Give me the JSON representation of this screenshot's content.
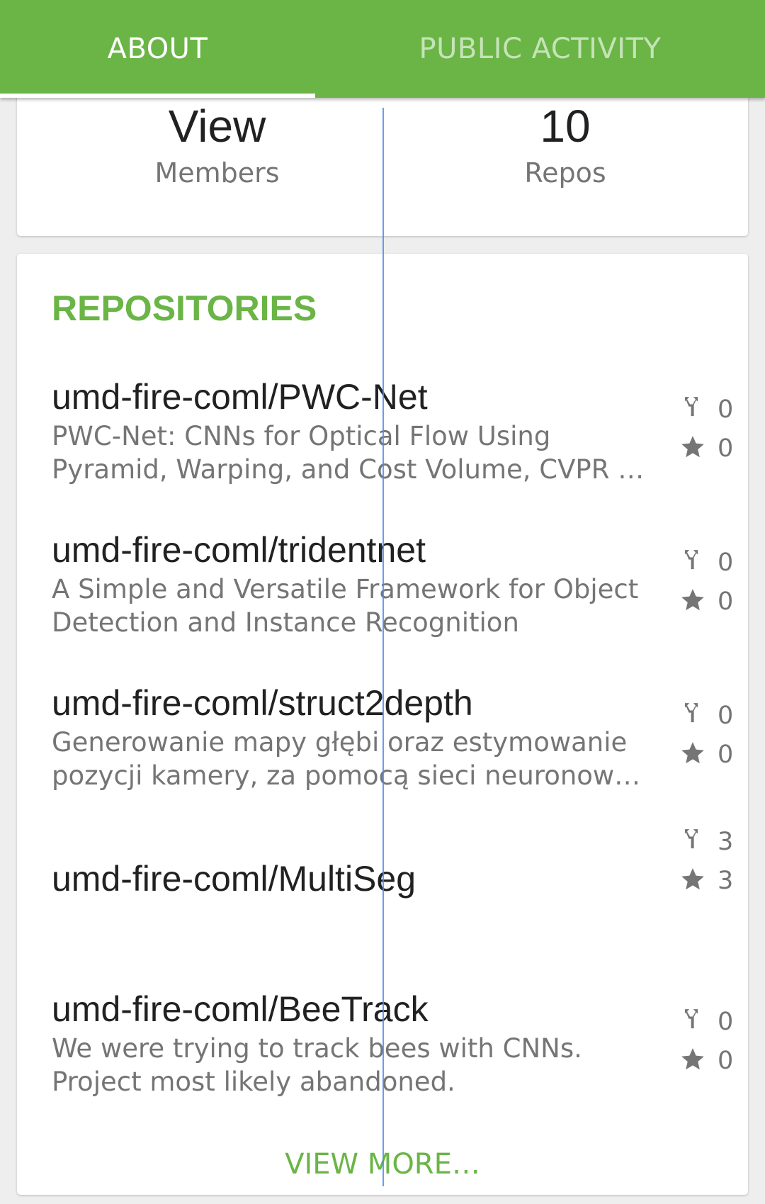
{
  "tabs": {
    "about": "ABOUT",
    "public_activity": "PUBLIC ACTIVITY"
  },
  "stats": {
    "members_value": "View",
    "members_label": "Members",
    "repos_value": "10",
    "repos_label": "Repos"
  },
  "repositories": {
    "title": "REPOSITORIES",
    "items": [
      {
        "name": "umd-fire-coml/PWC-Net",
        "description_line1": "PWC-Net: CNNs for Optical Flow Using",
        "description_line2": "Pyramid, Warping, and Cost Volume, CVPR …",
        "forks": "0",
        "stars": "0"
      },
      {
        "name": "umd-fire-coml/tridentnet",
        "description_line1": "A Simple and Versatile Framework for Object",
        "description_line2": "Detection and Instance Recognition",
        "forks": "0",
        "stars": "0"
      },
      {
        "name": "umd-fire-coml/struct2depth",
        "description_line1": "Generowanie mapy głębi oraz estymowanie",
        "description_line2": "pozycji kamery, za pomocą sieci neuronow…",
        "forks": "0",
        "stars": "0"
      },
      {
        "name": "umd-fire-coml/MultiSeg",
        "description_line1": "",
        "description_line2": "",
        "forks": "3",
        "stars": "3"
      },
      {
        "name": "umd-fire-coml/BeeTrack",
        "description_line1": "We were trying to track bees with CNNs.",
        "description_line2": "Project most likely abandoned.",
        "forks": "0",
        "stars": "0"
      }
    ],
    "view_more": "VIEW MORE…"
  },
  "colors": {
    "accent": "#6ab546",
    "icon_gray": "#757575"
  },
  "icons": {
    "fork": "fork-icon",
    "star": "star-icon"
  }
}
